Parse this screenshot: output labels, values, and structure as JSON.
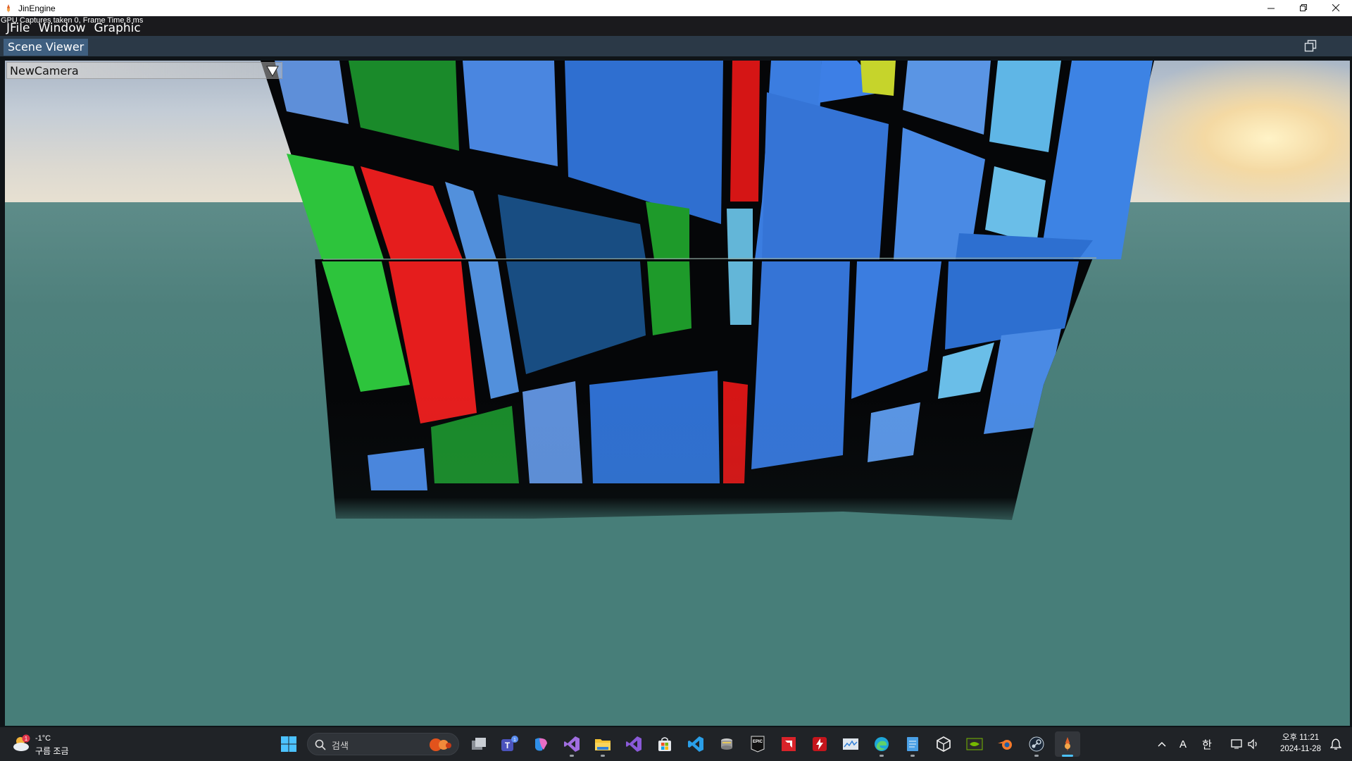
{
  "window": {
    "title": "JinEngine"
  },
  "stats": {
    "gpu_line": "GPU Captures taken 0, Frame Time 8 ms"
  },
  "menu": {
    "items": [
      "JFile",
      "Window",
      "Graphic"
    ]
  },
  "panel": {
    "tab_label": "Scene Viewer"
  },
  "viewport": {
    "camera_selected": "NewCamera"
  },
  "taskbar": {
    "weather_temp": "-1°C",
    "weather_desc": "구름 조금",
    "weather_badge": "1",
    "search_placeholder": "검색",
    "teams_badge": "1",
    "ime_alpha": "A",
    "ime_korean": "한",
    "time": "오후 11:21",
    "date": "2024-11-28"
  },
  "colors": {
    "tab_active": "#3f5f80",
    "taskbar_bg": "#202327",
    "accent": "#4cc2ff",
    "ground": "#477e79"
  }
}
